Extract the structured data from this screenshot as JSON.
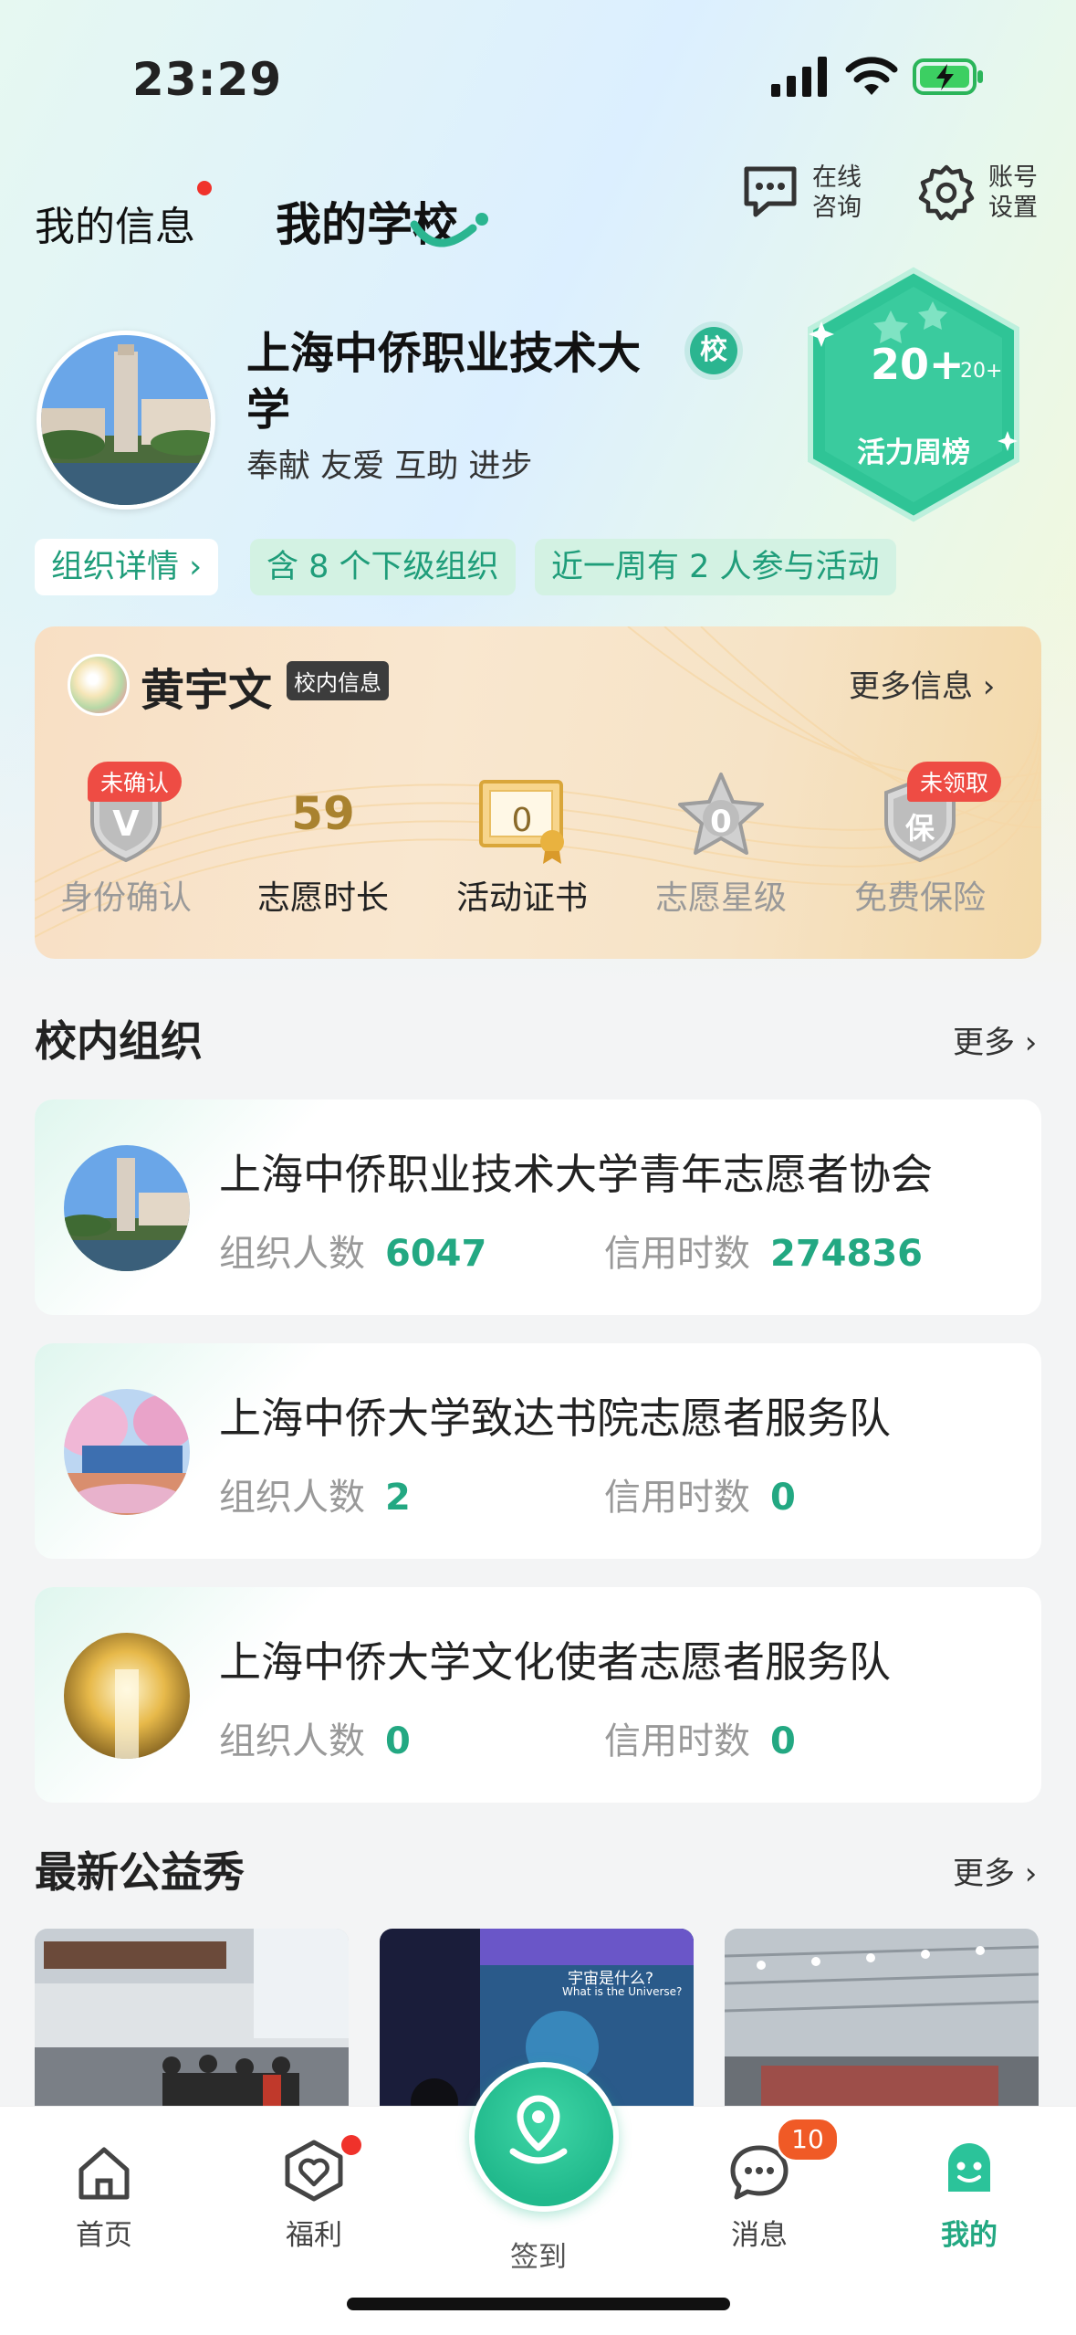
{
  "status_bar": {
    "time": "23:29"
  },
  "header": {
    "tab_my_info": "我的信息",
    "tab_my_school": "我的学校",
    "consult_label_1": "在线",
    "consult_label_2": "咨询",
    "settings_label_1": "账号",
    "settings_label_2": "设置"
  },
  "school": {
    "name": "上海中侨职业技术大学",
    "badge": "校",
    "motto": "奉献 友爱 互助 进步",
    "weekly_value": "20+",
    "weekly_small": "20+",
    "weekly_label": "活力周榜",
    "tags": {
      "detail": "组织详情",
      "sub_orgs": "含 8 个下级组织",
      "active": "近一周有 2 人参与活动"
    }
  },
  "profile": {
    "name": "黄宇文",
    "tag": "校内信息",
    "more": "更多信息",
    "stats": [
      {
        "label": "身份确认",
        "badge": "未确认",
        "icon_text": "V"
      },
      {
        "label": "志愿时长",
        "value": "59"
      },
      {
        "label": "活动证书",
        "icon_text": "0"
      },
      {
        "label": "志愿星级",
        "icon_text": "0"
      },
      {
        "label": "免费保险",
        "badge": "未领取",
        "icon_text": "保"
      }
    ]
  },
  "orgs_section": {
    "title": "校内组织",
    "more": "更多"
  },
  "orgs": [
    {
      "name": "上海中侨职业技术大学青年志愿者协会",
      "members_label": "组织人数",
      "members": "6047",
      "hours_label": "信用时数",
      "hours": "274836"
    },
    {
      "name": "上海中侨大学致达书院志愿者服务队",
      "members_label": "组织人数",
      "members": "2",
      "hours_label": "信用时数",
      "hours": "0"
    },
    {
      "name": "上海中侨大学文化使者志愿者服务队",
      "members_label": "组织人数",
      "members": "0",
      "hours_label": "信用时数",
      "hours": "0"
    }
  ],
  "showcase": {
    "title": "最新公益秀",
    "more": "更多",
    "second_image_text_1": "宇宙是什么?",
    "second_image_text_2": "What is the Universe?"
  },
  "tabbar": {
    "home": "首页",
    "welfare": "福利",
    "checkin": "签到",
    "messages": "消息",
    "messages_badge": "10",
    "mine": "我的"
  },
  "colors": {
    "accent": "#23a882",
    "badge_red": "#ee4c44",
    "card_gold": "#f6e3c6"
  }
}
